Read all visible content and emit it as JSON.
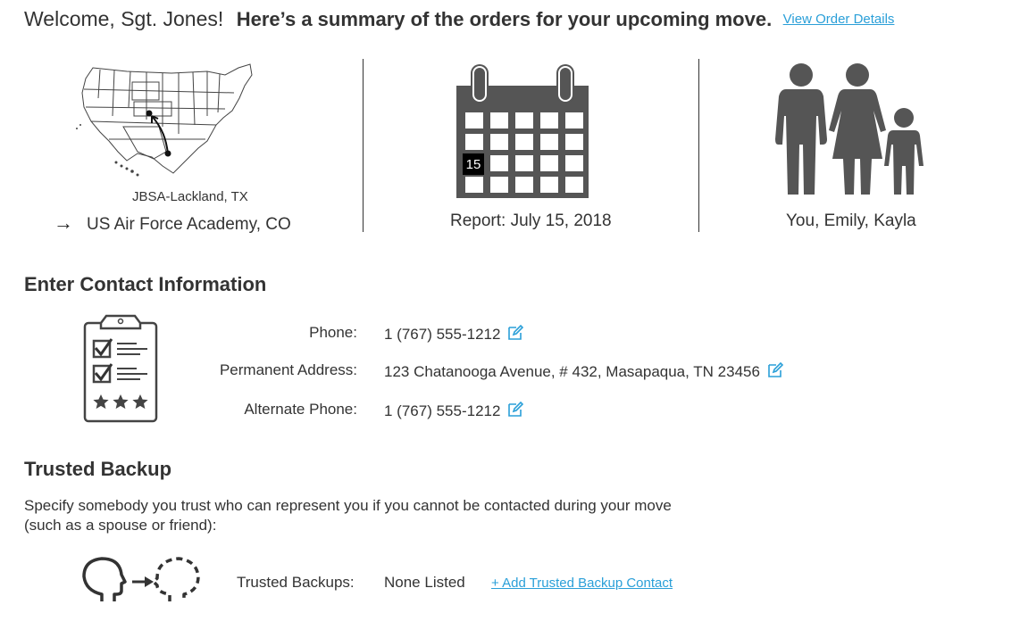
{
  "header": {
    "greeting": "Welcome, Sgt. Jones!",
    "summary": "Here’s a summary of the orders for your upcoming move.",
    "view_link": "View Order Details"
  },
  "move": {
    "from": "JBSA-Lackland, TX",
    "to": "US Air Force Academy, CO",
    "arrow": "→",
    "map_icon": "us-map-route-icon"
  },
  "report": {
    "calendar_day": "15",
    "text": "Report:  July 15, 2018",
    "calendar_icon": "calendar-icon"
  },
  "family": {
    "members": "You, Emily, Kayla",
    "icon": "family-icon"
  },
  "contact": {
    "title": "Enter Contact Information",
    "icon": "clipboard-checklist-icon",
    "phone_label": "Phone:",
    "phone_value": "1 (767) 555-1212",
    "address_label": "Permanent Address:",
    "address_value": "123 Chatanooga Avenue, # 432, Masapaqua, TN 23456",
    "alt_phone_label": "Alternate Phone:",
    "alt_phone_value": "1 (767) 555-1212",
    "edit_icon": "edit-pencil-icon"
  },
  "backup": {
    "title": "Trusted Backup",
    "description_line1": "Specify somebody you trust who can represent you if you cannot be contacted during your move",
    "description_line2": "(such as a spouse or friend):",
    "icon": "trusted-backup-heads-icon",
    "label": "Trusted Backups:",
    "value": "None Listed",
    "add_link": "+ Add Trusted Backup Contact"
  },
  "colors": {
    "link": "#2a9fd8",
    "icon_gray": "#555555",
    "text": "#333333"
  }
}
